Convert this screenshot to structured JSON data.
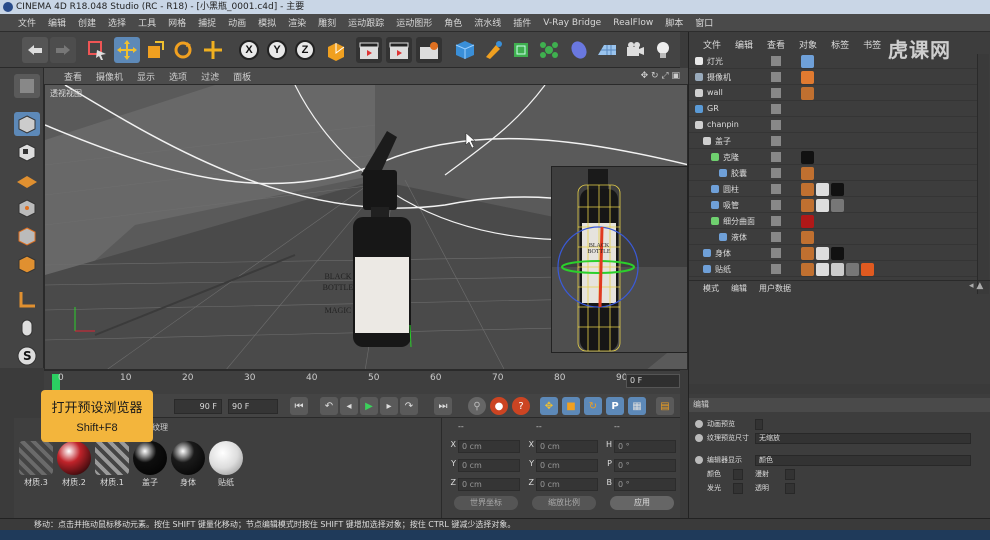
{
  "window": {
    "title": "CINEMA 4D R18.048 Studio (RC - R18) - [小黑瓶_0001.c4d] - 主要"
  },
  "menu": [
    "文件",
    "编辑",
    "创建",
    "选择",
    "工具",
    "网格",
    "捕捉",
    "动画",
    "模拟",
    "渲染",
    "雕刻",
    "运动跟踪",
    "运动图形",
    "角色",
    "流水线",
    "插件",
    "V-Ray Bridge",
    "RealFlow",
    "脚本",
    "窗口"
  ],
  "toolbar": {
    "axis_labels": [
      "X",
      "Y",
      "Z"
    ]
  },
  "viewport": {
    "menu": [
      "查看",
      "摄像机",
      "显示",
      "选项",
      "过滤",
      "面板"
    ],
    "label": "透视视图",
    "bottle_main": {
      "line1": "BLACK BOTTLE",
      "line2": "MAGIC"
    },
    "bottle_inset": {
      "line1": "BLACK BOTTLE"
    }
  },
  "timeline": {
    "ticks": [
      "0",
      "10",
      "20",
      "30",
      "40",
      "50",
      "60",
      "70",
      "80",
      "90"
    ],
    "current_frame": "0 F",
    "start_field": "90 F",
    "end_field": "90 F"
  },
  "tooltip": {
    "line1": "打开预设浏览器",
    "line2": "Shift+F8"
  },
  "material_panel": {
    "tab_partial": "纹理",
    "materials": [
      {
        "name": "材质.3",
        "color": "#6a6a6a",
        "icon": "striped-material-icon"
      },
      {
        "name": "材质.2",
        "color": "#c0232a",
        "icon": "red-material-icon"
      },
      {
        "name": "材质.1",
        "color": "#9a9a9a",
        "icon": "striped-material-icon"
      },
      {
        "name": "盖子",
        "color": "#0e0e0e",
        "icon": "black-material-icon"
      },
      {
        "name": "身体",
        "color": "#1a1a1a",
        "icon": "black-material-icon"
      },
      {
        "name": "贴纸",
        "color": "#e6e6e6",
        "icon": "white-material-icon"
      }
    ]
  },
  "coordinates": {
    "header": [
      "--",
      "--",
      "--"
    ],
    "rows": [
      {
        "a_label": "X",
        "a": "0 cm",
        "b_label": "X",
        "b": "0 cm",
        "c_label": "H",
        "c": "0 °"
      },
      {
        "a_label": "Y",
        "a": "0 cm",
        "b_label": "Y",
        "b": "0 cm",
        "c_label": "P",
        "c": "0 °"
      },
      {
        "a_label": "Z",
        "a": "0 cm",
        "b_label": "Z",
        "b": "0 cm",
        "c_label": "B",
        "c": "0 °"
      }
    ],
    "mode_select": "世界坐标",
    "scale_select": "缩放比例",
    "apply_label": "应用"
  },
  "status": {
    "text": "移动：点击并拖动鼠标移动元素。按住 SHIFT 键量化移动；节点编辑模式时按住 SHIFT 键增加选择对象；按住 CTRL 键减少选择对象。"
  },
  "object_manager": {
    "menu": [
      "文件",
      "编辑",
      "查看",
      "对象",
      "标签",
      "书签"
    ],
    "objects": [
      {
        "name": "灯光",
        "indent": 0,
        "icon_color": "#e8e8e8",
        "tags": [
          "#6fa0d8"
        ]
      },
      {
        "name": "摄像机",
        "indent": 0,
        "icon_color": "#9ab",
        "tags": [
          "#e07a30"
        ]
      },
      {
        "name": "wall",
        "indent": 0,
        "icon_color": "#cfcfcf",
        "tags": [
          "#c07030"
        ]
      },
      {
        "name": "GR",
        "indent": 0,
        "icon_color": "#5a9ad6",
        "tags": []
      },
      {
        "name": "chanpin",
        "indent": 0,
        "icon_color": "#cfcfcf",
        "tags": []
      },
      {
        "name": "盖子",
        "indent": 1,
        "icon_color": "#cfcfcf",
        "tags": []
      },
      {
        "name": "克隆",
        "indent": 2,
        "icon_color": "#6fd06f",
        "tags": [
          "#111"
        ]
      },
      {
        "name": "胶囊",
        "indent": 3,
        "icon_color": "#6fa0d8",
        "tags": [
          "#c07030"
        ]
      },
      {
        "name": "圆柱",
        "indent": 2,
        "icon_color": "#6fa0d8",
        "tags": [
          "#c07030",
          "#ddd",
          "#111"
        ]
      },
      {
        "name": "吸管",
        "indent": 2,
        "icon_color": "#6fa0d8",
        "tags": [
          "#c07030",
          "#ddd",
          "#777"
        ]
      },
      {
        "name": "细分曲面",
        "indent": 2,
        "icon_color": "#6fd06f",
        "tags": [
          "#b01818"
        ]
      },
      {
        "name": "液体",
        "indent": 3,
        "icon_color": "#6fa0d8",
        "tags": [
          "#c07030"
        ]
      },
      {
        "name": "身体",
        "indent": 1,
        "icon_color": "#6fa0d8",
        "tags": [
          "#c07030",
          "#ddd",
          "#111"
        ]
      },
      {
        "name": "贴纸",
        "indent": 1,
        "icon_color": "#6fa0d8",
        "tags": [
          "#c07030",
          "#ddd",
          "#ccc",
          "#777",
          "#e05a20"
        ]
      }
    ]
  },
  "attributes": {
    "menu": [
      "模式",
      "编辑",
      "用户数据"
    ],
    "section": "编辑",
    "rows": [
      {
        "label": "动画预览",
        "value": ""
      },
      {
        "label": "纹理预览尺寸",
        "value": "无缩放"
      },
      {
        "label": "编辑器显示",
        "value": "颜色"
      },
      {
        "label": "颜色",
        "value": "",
        "label2": "漫射",
        "value2": ""
      },
      {
        "label": "发光",
        "value": "",
        "label2": "透明",
        "value2": ""
      }
    ]
  },
  "watermark": "虎课网"
}
